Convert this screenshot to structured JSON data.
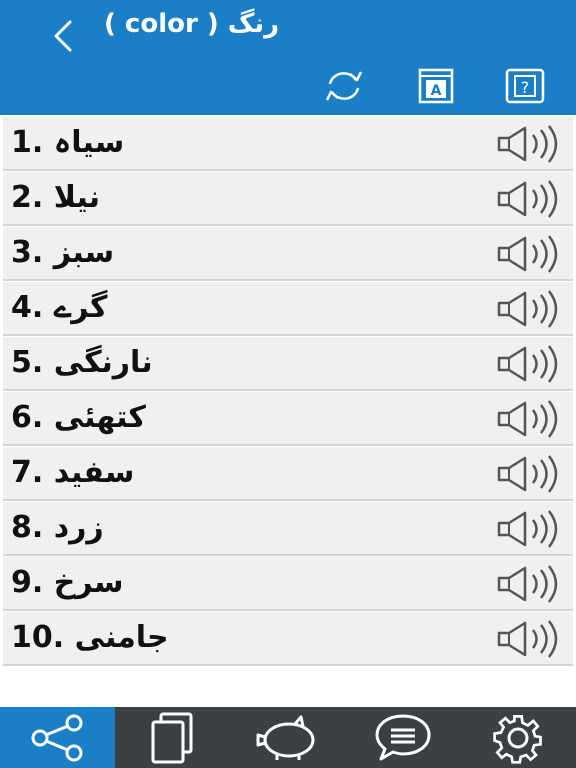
{
  "header": {
    "title": "( color ) رنگ",
    "back_icon": "chevron-left-icon",
    "tools": [
      "refresh-icon",
      "dictionary-icon",
      "help-icon"
    ],
    "color": "#1a7fc7"
  },
  "list": {
    "items": [
      {
        "number": "1.",
        "word": "سیاہ",
        "label": "سیاہ .1"
      },
      {
        "number": "2.",
        "word": "نیلا",
        "label": "نیلا .2"
      },
      {
        "number": "3.",
        "word": "سبز",
        "label": "سبز .3"
      },
      {
        "number": "4.",
        "word": "گرے",
        "label": "گرے .4"
      },
      {
        "number": "5.",
        "word": "نارنگی",
        "label": "نارنگی .5"
      },
      {
        "number": "6.",
        "word": "کتھئی",
        "label": "کتھئی .6"
      },
      {
        "number": "7.",
        "word": "سفید",
        "label": "سفید .7"
      },
      {
        "number": "8.",
        "word": "زرد",
        "label": "زرد .8"
      },
      {
        "number": "9.",
        "word": "سرخ",
        "label": "سرخ .9"
      },
      {
        "number": "10.",
        "word": "جامنی",
        "label": "جامنی .10"
      }
    ],
    "speaker_icon": "speaker-icon"
  },
  "tabbar": {
    "tabs": [
      "share-icon",
      "copy-icon",
      "piggy-bank-icon",
      "chat-icon",
      "settings-icon"
    ],
    "active_index": 0,
    "active_color": "#1a7fc7",
    "background": "#3c4043"
  }
}
